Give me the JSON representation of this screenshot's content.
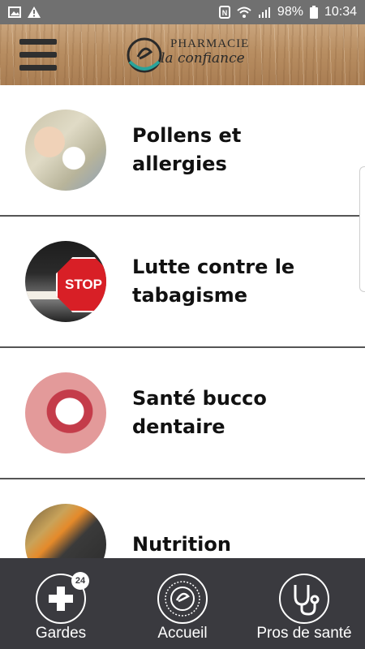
{
  "status_bar": {
    "battery_percent": "98%",
    "time": "10:34",
    "icons": [
      "image-icon",
      "warning-icon",
      "nfc-icon",
      "wifi-icon",
      "signal-icon",
      "battery-icon"
    ]
  },
  "header": {
    "brand_top": "PHARMACIE",
    "brand_bottom": "la confiance",
    "menu_icon": "hamburger-icon"
  },
  "topics": [
    {
      "label": "Pollens et allergies",
      "image": "pollen-allergy-photo"
    },
    {
      "label": "Lutte contre le tabagisme",
      "image": "stop-smoking-photo",
      "sign_text": "STOP"
    },
    {
      "label": "Santé bucco dentaire",
      "image": "teeth-smile-photo"
    },
    {
      "label": "Nutrition",
      "image": "vegetables-photo"
    }
  ],
  "bottom_nav": [
    {
      "label": "Gardes",
      "icon": "medical-cross-24h-icon",
      "badge": "24"
    },
    {
      "label": "Accueil",
      "icon": "pharmacy-logo-icon"
    },
    {
      "label": "Pros de santé",
      "icon": "stethoscope-icon"
    }
  ],
  "colors": {
    "status_bar_bg": "#707070",
    "nav_bg": "#3a3a3f",
    "stop_red": "#d81f26",
    "logo_teal": "#2aa39a"
  }
}
